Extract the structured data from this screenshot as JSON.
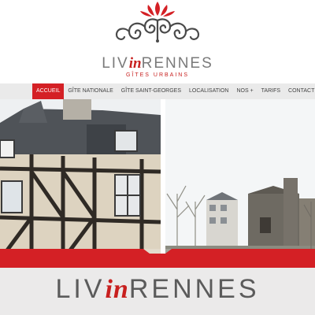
{
  "brand": {
    "name_part1": "LIV",
    "name_in": "in",
    "name_part2": "RENNES",
    "subtitle": "GÎTES URBAINS"
  },
  "nav": {
    "items": [
      {
        "label": "ACCUEIL",
        "active": true
      },
      {
        "label": "GÎTE NATIONALE",
        "active": false
      },
      {
        "label": "GÎTE SAINT-GEORGES",
        "active": false
      },
      {
        "label": "LOCALISATION",
        "active": false
      },
      {
        "label": "NOS +",
        "active": false
      },
      {
        "label": "TARIFS",
        "active": false
      },
      {
        "label": "CONTACT",
        "active": false
      }
    ]
  },
  "footer_brand": {
    "name_part1": "LIV",
    "name_in": "in",
    "name_part2": "RENNES"
  },
  "colors": {
    "accent": "#c8201f",
    "nav_bg": "#eaeaea",
    "text_gray": "#7a7a7a"
  }
}
